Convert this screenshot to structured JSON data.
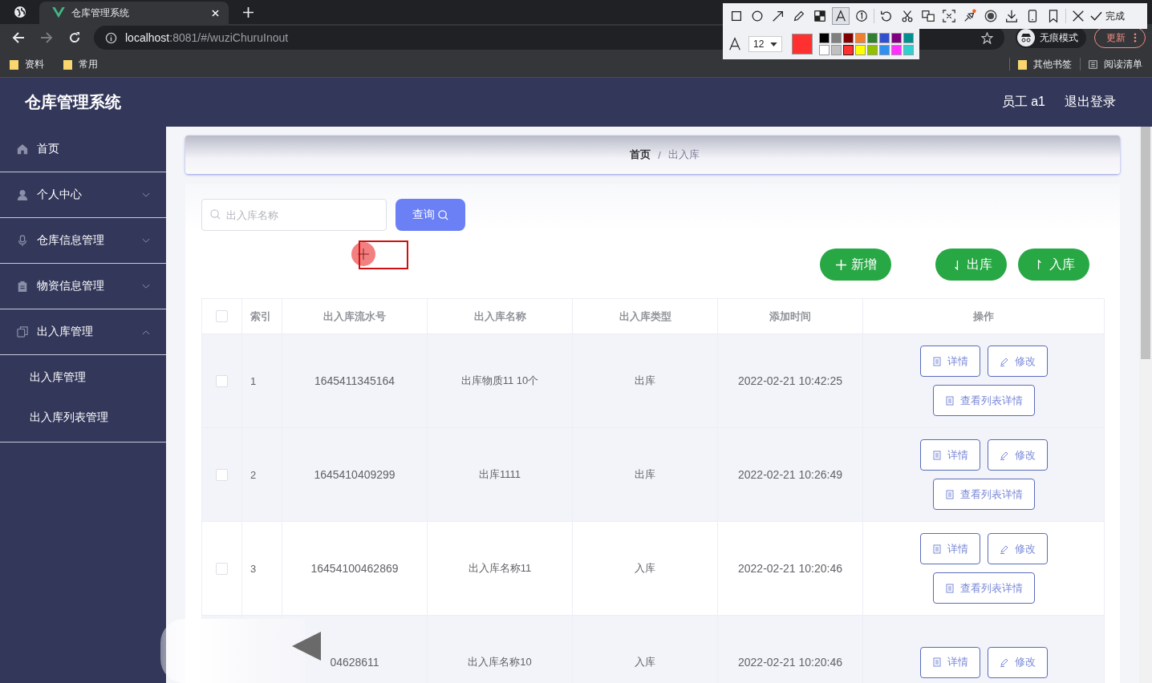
{
  "browser": {
    "tab_title": "仓库管理系统",
    "url_host": "localhost",
    "url_rest": ":8081/#/wuziChuruInout",
    "bookmarks": [
      "资料",
      "常用"
    ],
    "right_bookmarks": [
      {
        "kind": "folder",
        "label": "其他书签"
      },
      {
        "kind": "list",
        "label": "阅读清单"
      }
    ],
    "profile": "无痕模式",
    "update": "更新"
  },
  "capture_toolbar": {
    "tool_groups": [
      [
        {
          "kind": "rect",
          "selected": false
        },
        {
          "kind": "circle",
          "selected": false
        },
        {
          "kind": "arrow",
          "selected": false
        },
        {
          "kind": "pen",
          "selected": false
        },
        {
          "kind": "mosaic",
          "selected": false
        },
        {
          "kind": "text",
          "selected": true
        },
        {
          "kind": "number",
          "selected": false
        }
      ],
      [
        {
          "kind": "undo",
          "selected": false
        },
        {
          "kind": "cut",
          "selected": false
        },
        {
          "kind": "translate",
          "selected": false
        },
        {
          "kind": "ocr",
          "selected": false
        },
        {
          "kind": "pin",
          "selected": false
        },
        {
          "kind": "record",
          "selected": false
        },
        {
          "kind": "download",
          "selected": false
        },
        {
          "kind": "phone",
          "selected": false
        },
        {
          "kind": "bookmark",
          "selected": false
        }
      ],
      [
        {
          "kind": "close",
          "selected": false
        }
      ]
    ],
    "done": "完成",
    "font_size": "12",
    "swatches": [
      {
        "color": "#000000",
        "selected": false
      },
      {
        "color": "#808080",
        "selected": false
      },
      {
        "color": "#800000",
        "selected": false
      },
      {
        "color": "#f08030",
        "selected": false
      },
      {
        "color": "#308030",
        "selected": false
      },
      {
        "color": "#3050d0",
        "selected": false
      },
      {
        "color": "#800080",
        "selected": false
      },
      {
        "color": "#009090",
        "selected": false
      },
      {
        "color": "#ffffff",
        "selected": false
      },
      {
        "color": "#c0c0c0",
        "selected": false
      },
      {
        "color": "#ff3030",
        "selected": true
      },
      {
        "color": "#ffff00",
        "selected": false
      },
      {
        "color": "#90c000",
        "selected": false
      },
      {
        "color": "#3090f0",
        "selected": false
      },
      {
        "color": "#ff30ff",
        "selected": false
      },
      {
        "color": "#30d0d0",
        "selected": false
      }
    ]
  },
  "app": {
    "title": "仓库管理系统",
    "user": "员工 a1",
    "logout": "退出登录"
  },
  "sidebar": {
    "items": [
      {
        "label": "首页"
      },
      {
        "label": "个人中心",
        "expanded": false
      },
      {
        "label": "仓库信息管理",
        "expanded": false
      },
      {
        "label": "物资信息管理",
        "expanded": false
      },
      {
        "label": "出入库管理",
        "expanded": true,
        "children": [
          {
            "label": "出入库管理"
          },
          {
            "label": "出入库列表管理"
          }
        ]
      }
    ]
  },
  "breadcrumb": {
    "items": [
      "首页",
      "出入库"
    ],
    "separator": "/"
  },
  "search": {
    "placeholder": "出入库名称",
    "button": "查询"
  },
  "actions": [
    {
      "kind": "add",
      "label": "新增"
    },
    {
      "kind": "out",
      "label": "出库"
    },
    {
      "kind": "in",
      "label": "入库"
    }
  ],
  "table": {
    "select_all_checked": false,
    "columns": [
      "索引",
      "出入库流水号",
      "出入库名称",
      "出入库类型",
      "添加时间",
      "操作"
    ],
    "rows": [
      {
        "checked": false,
        "index": "1",
        "serial": "1645411345164",
        "name": "出库物质11 10个",
        "type": "出库",
        "time": "2022-02-21 10:42:25",
        "shaded": true,
        "actions": [
          {
            "kind": "detail",
            "label": "详情"
          },
          {
            "kind": "edit",
            "label": "修改"
          },
          {
            "kind": "list",
            "label": "查看列表详情"
          }
        ]
      },
      {
        "checked": false,
        "index": "2",
        "serial": "1645410409299",
        "name": "出库1111",
        "type": "出库",
        "time": "2022-02-21 10:26:49",
        "shaded": true,
        "actions": [
          {
            "kind": "detail",
            "label": "详情"
          },
          {
            "kind": "edit",
            "label": "修改"
          },
          {
            "kind": "list",
            "label": "查看列表详情"
          }
        ]
      },
      {
        "checked": false,
        "index": "3",
        "serial": "16454100462869",
        "name": "出入库名称11",
        "type": "入库",
        "time": "2022-02-21 10:20:46",
        "shaded": false,
        "actions": [
          {
            "kind": "detail",
            "label": "详情"
          },
          {
            "kind": "edit",
            "label": "修改"
          },
          {
            "kind": "list",
            "label": "查看列表详情"
          }
        ]
      },
      {
        "serial": "04628611",
        "name": "出入库名称10",
        "type": "入库",
        "time": "2022-02-21 10:20:46",
        "shaded": true,
        "actions": [
          {
            "kind": "detail",
            "label": "详情"
          },
          {
            "kind": "edit",
            "label": "修改"
          }
        ]
      }
    ]
  }
}
